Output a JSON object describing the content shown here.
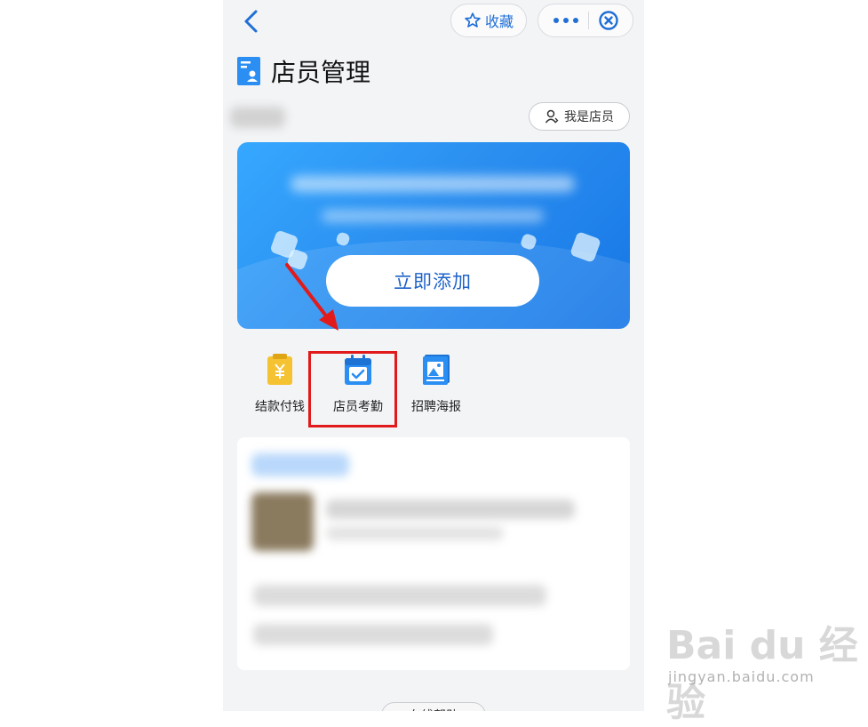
{
  "header": {
    "favorite_label": "收藏"
  },
  "page": {
    "title": "店员管理"
  },
  "role_button": {
    "label": "我是店员"
  },
  "banner": {
    "add_button_label": "立即添加"
  },
  "actions": [
    {
      "label": "结款付钱",
      "icon": "receipt-icon"
    },
    {
      "label": "店员考勤",
      "icon": "calendar-check-icon"
    },
    {
      "label": "招聘海报",
      "icon": "poster-icon"
    }
  ],
  "footer": {
    "help_label": "在线帮助"
  },
  "watermark": {
    "logo": "Bai du 经验",
    "url": "jingyan.baidu.com"
  },
  "colors": {
    "accent": "#1f6fd6",
    "banner_blue": "#2b8ff0",
    "highlight_red": "#e11b1b"
  }
}
